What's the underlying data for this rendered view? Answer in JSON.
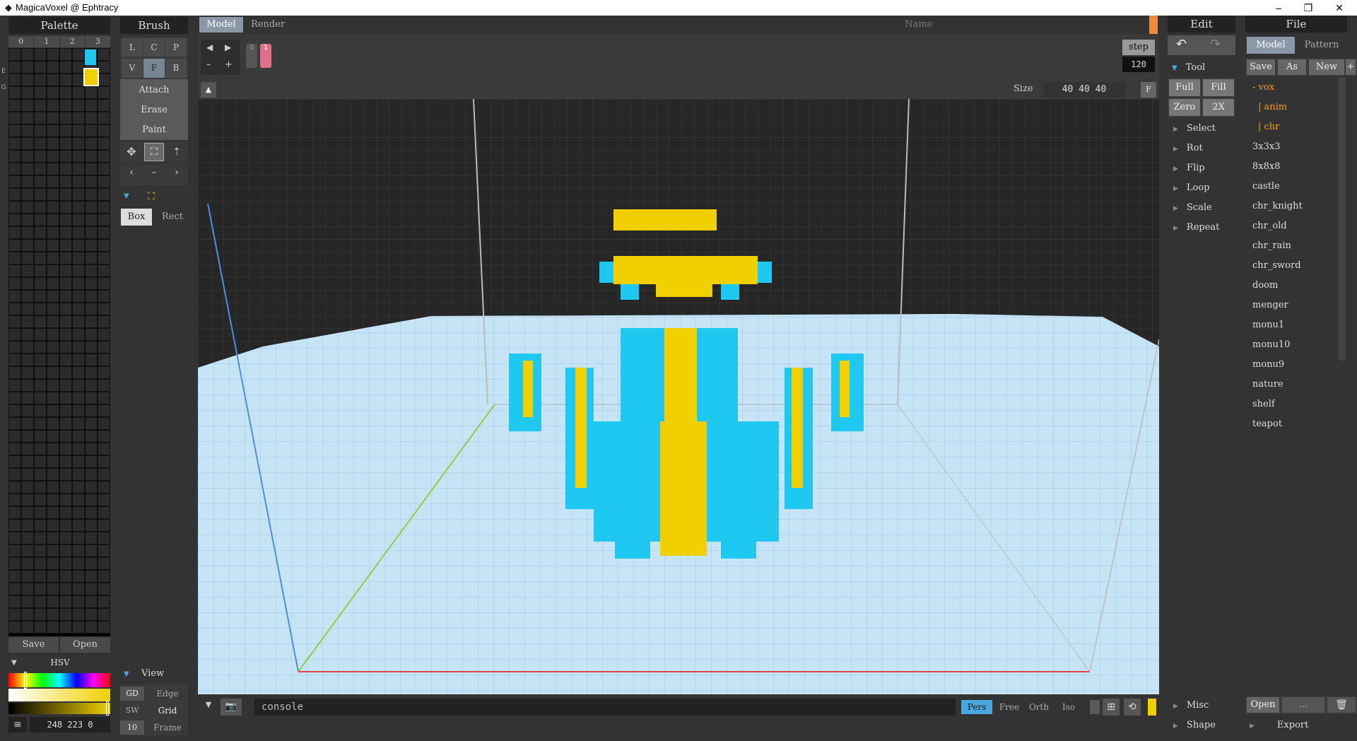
{
  "window": {
    "title": "MagicaVoxel @ Ephtracy",
    "app_icon": "magicavoxel-icon",
    "min": "–",
    "max": "❐",
    "close": "✕"
  },
  "palette": {
    "header": "Palette",
    "tabs": [
      "0",
      "1",
      "2",
      "3"
    ],
    "side_labels": [
      "E",
      "G"
    ],
    "selected_colors": [
      "#1ec8f0",
      "#f0d000"
    ],
    "save": "Save",
    "open": "Open",
    "mode": "HSV",
    "color_value": "248 223 0"
  },
  "brush": {
    "header": "Brush",
    "row1": [
      "L",
      "C",
      "P"
    ],
    "row2": [
      "V",
      "F",
      "B"
    ],
    "actions": [
      "Attach",
      "Erase",
      "Paint"
    ],
    "box": "Box",
    "rect": "Rect",
    "view_label": "View",
    "view_rows": [
      [
        "GD",
        "Edge"
      ],
      [
        "SW",
        "Grid"
      ],
      [
        "10",
        "Frame"
      ]
    ]
  },
  "viewport": {
    "tabs": [
      "Model",
      "Render"
    ],
    "name_placeholder": "Name",
    "frame_buttons": [
      "0",
      "1"
    ],
    "step_label": "step",
    "step_value": "120",
    "size_label": "Size",
    "size_value": "40 40 40",
    "size_f": "F",
    "console": "console",
    "camera_modes": [
      "Pers",
      "Free",
      "Orth",
      "Iso"
    ]
  },
  "edit": {
    "header": "Edit",
    "tool_label": "Tool",
    "tool_buttons": [
      "Full",
      "Fill",
      "Zero",
      "2X"
    ],
    "items": [
      "Select",
      "Rot",
      "Flip",
      "Loop",
      "Scale",
      "Repeat"
    ],
    "misc": "Misc",
    "shape": "Shape"
  },
  "file": {
    "header": "File",
    "tabs": [
      "Model",
      "Pattern"
    ],
    "buttons": [
      "Save",
      "As",
      "New",
      "+"
    ],
    "folders": [
      "- vox",
      "| anim",
      "| chr"
    ],
    "files": [
      "3x3x3",
      "8x8x8",
      "castle",
      "chr_knight",
      "chr_old",
      "chr_rain",
      "chr_sword",
      "doom",
      "menger",
      "monu1",
      "monu10",
      "monu9",
      "nature",
      "shelf",
      "teapot"
    ],
    "open": "Open",
    "more": "...",
    "export": "Export"
  },
  "colors": {
    "cyan": "#1ec8f0",
    "yellow": "#f0d000",
    "accent": "#f0883a",
    "pink": "#e0708a"
  }
}
